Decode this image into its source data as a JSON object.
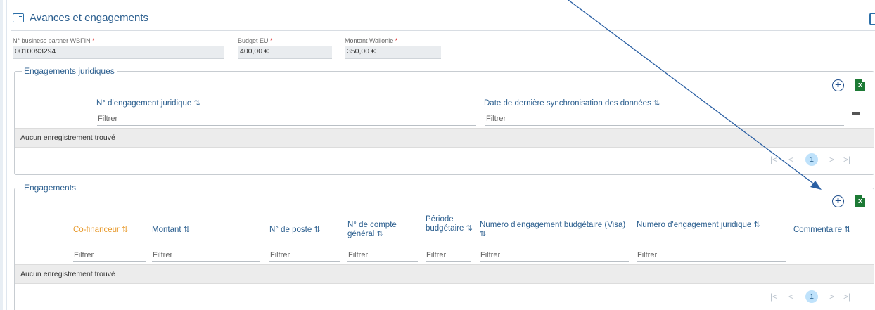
{
  "header": {
    "title": "Avances et engagements"
  },
  "fields": [
    {
      "label": "N° business partner WBFIN",
      "value": "0010093294",
      "required": "*"
    },
    {
      "label": "Budget EU",
      "value": "400,00 €",
      "required": "*"
    },
    {
      "label": "Montant Wallonie",
      "value": "350,00 €",
      "required": "*"
    }
  ],
  "juridiques": {
    "legend": "Engagements juridiques",
    "columns": [
      {
        "label": "N° d'engagement juridique",
        "sort": "⇅"
      },
      {
        "label": "Date de dernière synchronisation des données",
        "sort": "⇅"
      }
    ],
    "filter_placeholder": "Filtrer",
    "empty": "Aucun enregistrement trouvé",
    "pager": {
      "first": "|<",
      "prev": "<",
      "page": "1",
      "next": ">",
      "last": ">|"
    }
  },
  "engagements": {
    "legend": "Engagements",
    "columns": [
      {
        "label": "Co-financeur",
        "sort": "⇅"
      },
      {
        "label": "Montant",
        "sort": "⇅"
      },
      {
        "label": "N° de poste",
        "sort": "⇅"
      },
      {
        "label": "N° de compte général",
        "sort": "⇅"
      },
      {
        "label": "Période budgétaire",
        "sort": "⇅"
      },
      {
        "label": "Numéro d'engagement budgétaire (Visa)",
        "sort": "⇅"
      },
      {
        "label": "Numéro d'engagement juridique",
        "sort": "⇅"
      },
      {
        "label": "Commentaire",
        "sort": "⇅"
      }
    ],
    "filter_placeholder": "Filtrer",
    "empty": "Aucun enregistrement trouvé",
    "pager": {
      "first": "|<",
      "prev": "<",
      "page": "1",
      "next": ">",
      "last": ">|"
    }
  },
  "colors": {
    "accent": "#2c5f8f",
    "active_sort": "#e89a2c",
    "excel": "#1d7a35",
    "arrow": "#2a5fa3"
  }
}
